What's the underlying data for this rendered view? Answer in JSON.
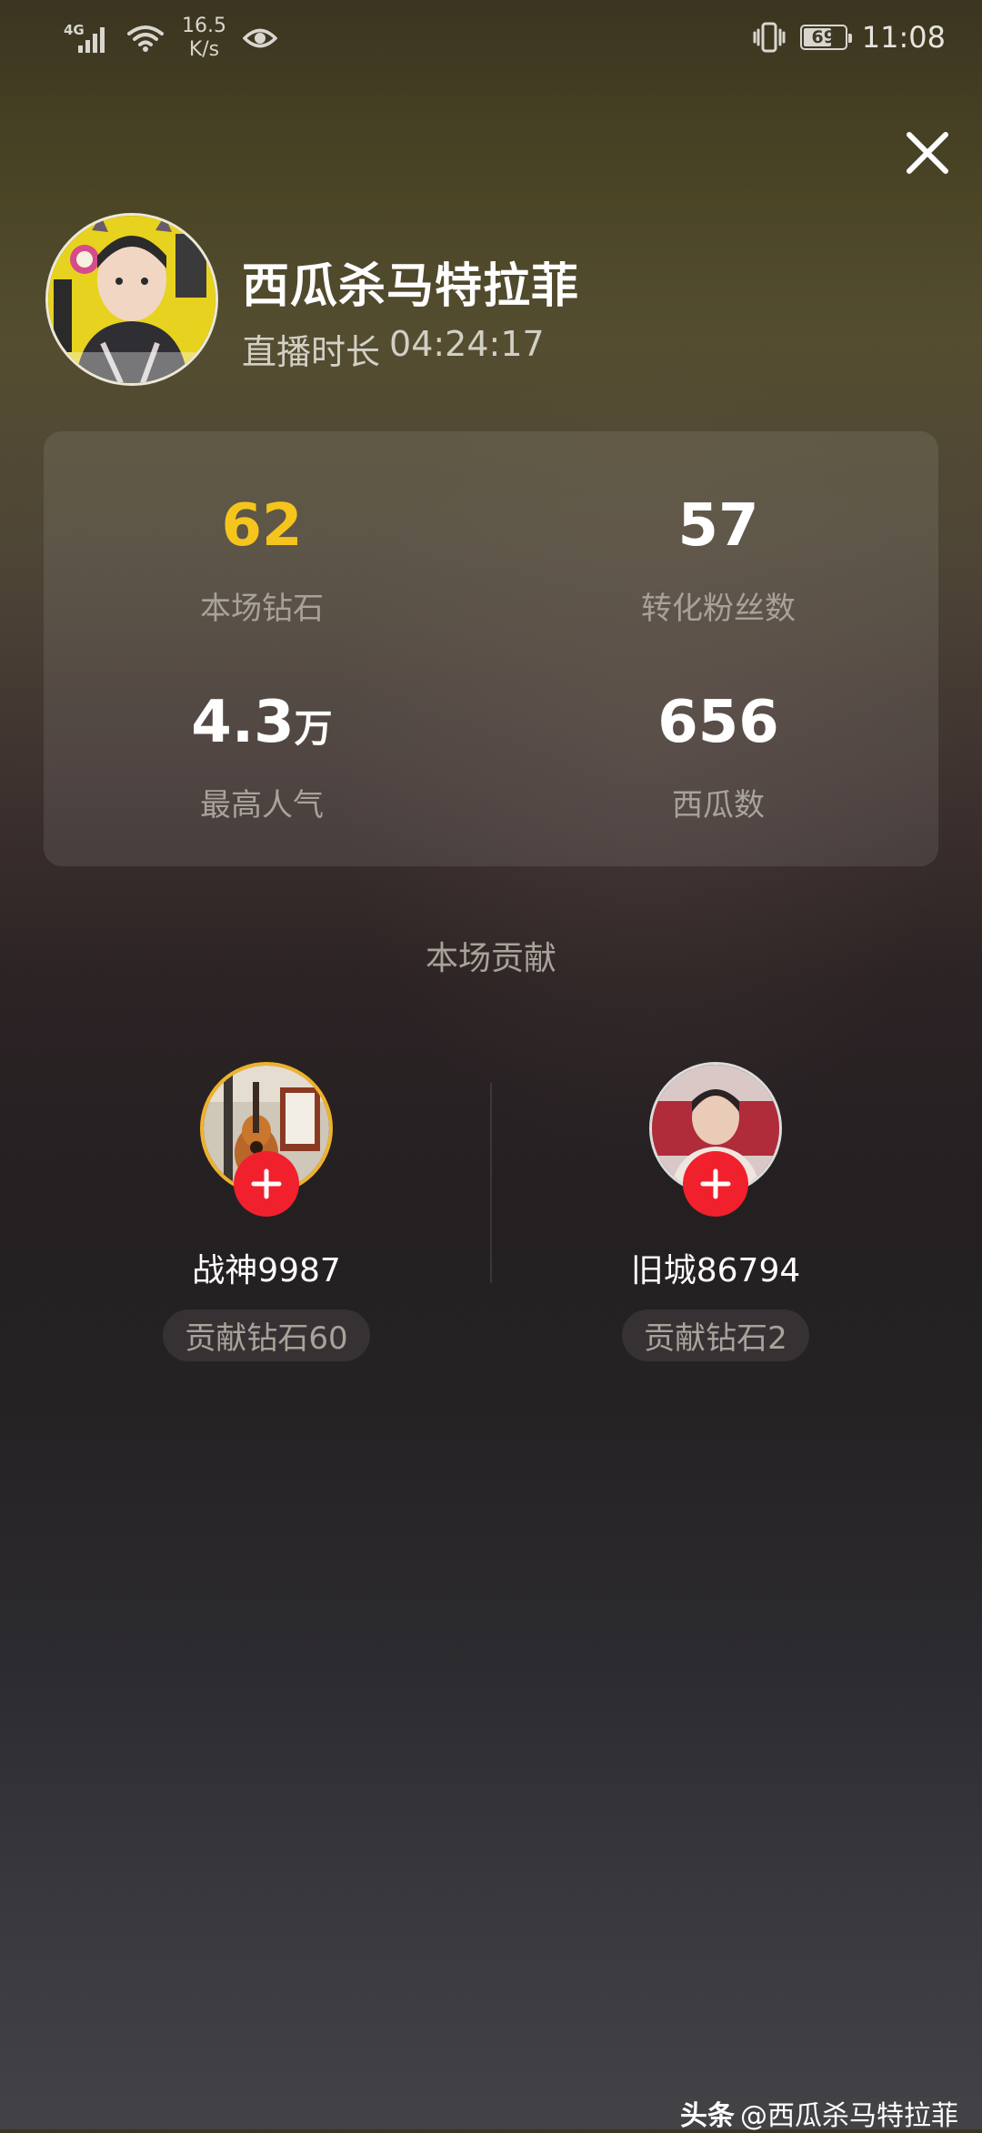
{
  "status_bar": {
    "network_type": "4G",
    "net_speed_value": "16.5",
    "net_speed_unit": "K/s",
    "battery_level": "69",
    "battery_fraction": 0.69,
    "time": "11:08"
  },
  "streamer": {
    "name": "西瓜杀马特拉菲",
    "duration_label": "直播时长",
    "duration_value": "04:24:17"
  },
  "stats": [
    {
      "value": "62",
      "unit": "",
      "label": "本场钻石",
      "highlight": true
    },
    {
      "value": "57",
      "unit": "",
      "label": "转化粉丝数",
      "highlight": false
    },
    {
      "value": "4.3",
      "unit": "万",
      "label": "最高人气",
      "highlight": false
    },
    {
      "value": "656",
      "unit": "",
      "label": "西瓜数",
      "highlight": false
    }
  ],
  "contribution": {
    "title": "本场贡献",
    "users": [
      {
        "name": "战神9987",
        "badge": "贡献钻石60"
      },
      {
        "name": "旧城86794",
        "badge": "贡献钻石2"
      }
    ]
  },
  "watermark": {
    "brand": "头条",
    "handle": "@西瓜杀马特拉菲"
  },
  "colors": {
    "gold": "#f5c51d",
    "follow_red": "#f0212c"
  }
}
